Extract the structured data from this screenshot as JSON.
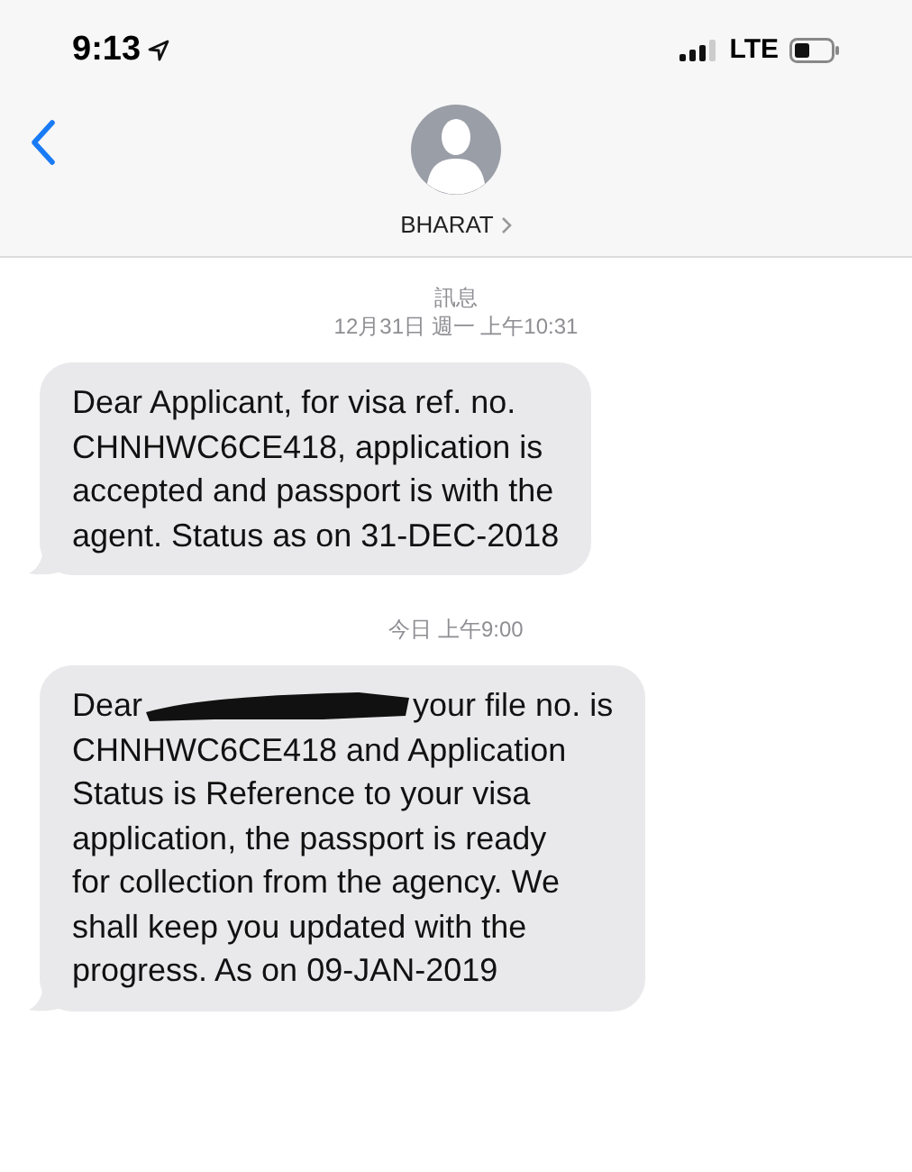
{
  "status_bar": {
    "time": "9:13",
    "network": "LTE"
  },
  "header": {
    "contact_name": "BHARAT"
  },
  "messages": [
    {
      "service": "訊息",
      "timestamp": "12月31日 週一 上午10:31",
      "lines": [
        {
          "text": "Dear Applicant, for visa ref. no."
        },
        {
          "text": "CHNHWC6CE418, application is"
        },
        {
          "text": "accepted and passport is with the"
        },
        {
          "text": "agent. Status as on 31-DEC-2018"
        }
      ]
    },
    {
      "timestamp": "今日 上午9:00",
      "lines": [
        {
          "text": "Dear",
          "redacted": true,
          "rest": "your file no. is"
        },
        {
          "text": "CHNHWC6CE418 and Application"
        },
        {
          "text": "Status is Reference to your visa"
        },
        {
          "text": "application, the passport is ready"
        },
        {
          "text": "for collection from the agency. We"
        },
        {
          "text": "shall keep you updated with the"
        },
        {
          "text": "progress. As on 09-JAN-2019"
        }
      ]
    }
  ]
}
